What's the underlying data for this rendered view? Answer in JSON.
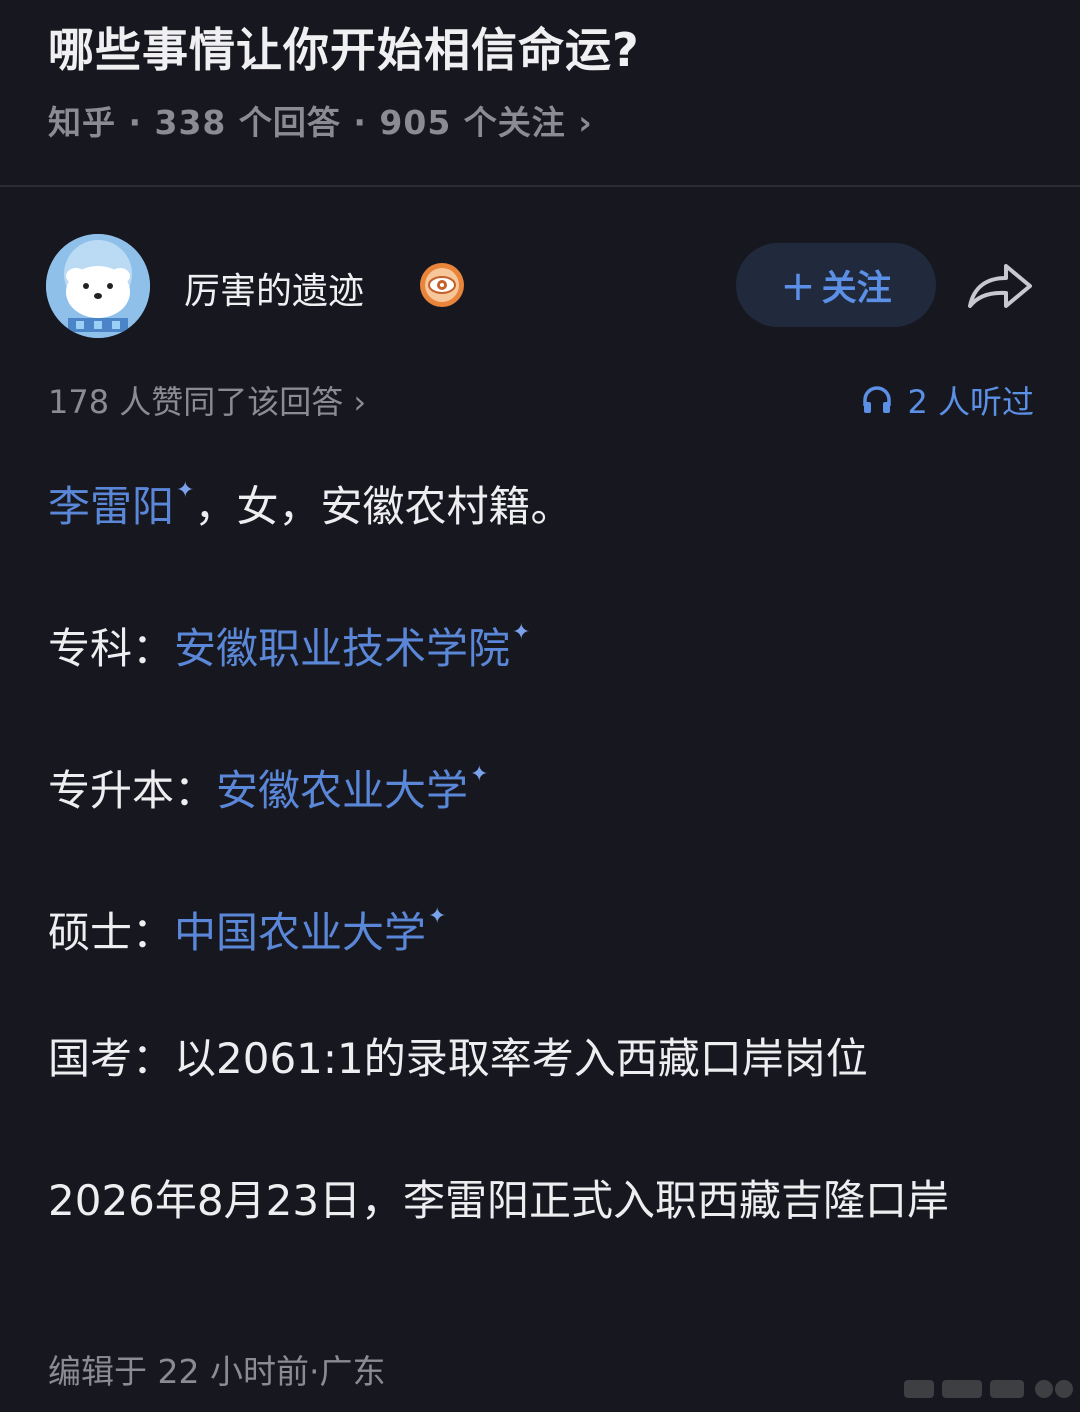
{
  "question": {
    "title": "哪些事情让你开始相信命运?",
    "meta": "知乎 · 338 个回答 · 905 个关注 ›"
  },
  "author": {
    "name": "厉害的遗迹",
    "follow_label": "关注",
    "follow_plus": "+",
    "avatar_icon": "polar-bear-avatar",
    "badge_icon": "eye-badge-icon",
    "share_icon": "share-arrow-icon"
  },
  "stats": {
    "approve": "178 人赞同了该回答 ›",
    "listen": "2 人听过",
    "listen_icon": "headphones-icon"
  },
  "answer": {
    "line1_link": "李雷阳",
    "line1_rest": "，女，安徽农村籍。",
    "line2_label": "专科：",
    "line2_link": "安徽职业技术学院",
    "line3_label": "专升本：",
    "line3_link": "安徽农业大学",
    "line4_label": "硕士：",
    "line4_link": "中国农业大学",
    "line5": "国考：以2061:1的录取率考入西藏口岸岗位",
    "line6": "2026年8月23日，李雷阳正式入职西藏吉隆口岸"
  },
  "footer": {
    "edited": "编辑于 22 小时前·广东"
  },
  "colors": {
    "background": "#17181f",
    "link": "#5b87d8",
    "accent": "#5b90e6",
    "muted": "#8b8c93"
  }
}
